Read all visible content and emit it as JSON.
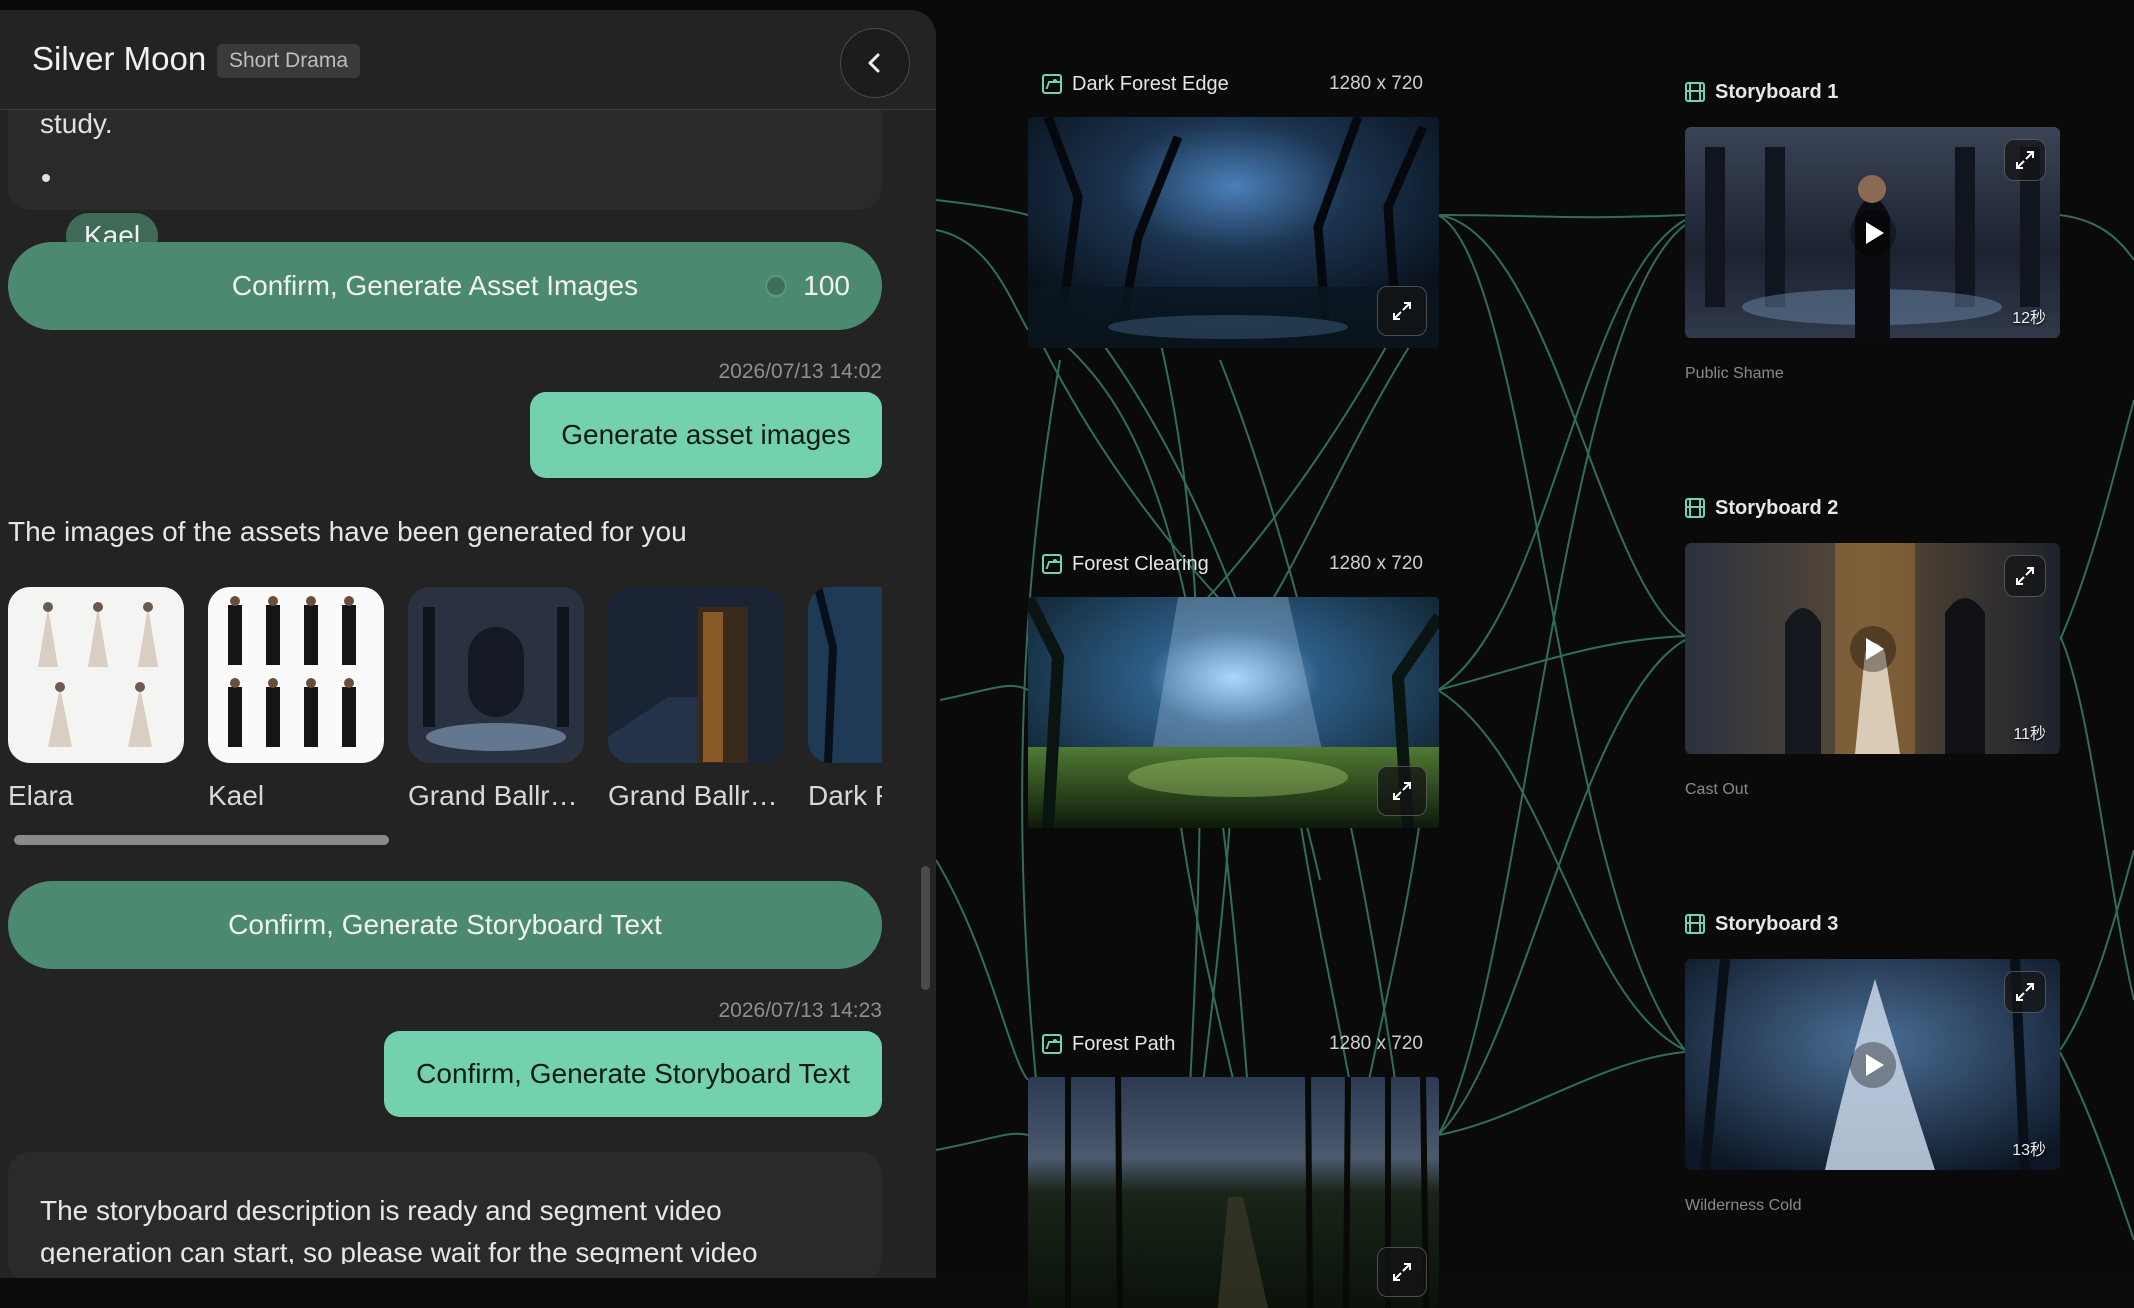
{
  "chat": {
    "title": "Silver Moon",
    "tag": "Short Drama",
    "back_icon": "chevron-left-icon",
    "partial_text": "study.",
    "character_chip": "Kael",
    "confirm_assets_label": "Confirm, Generate Asset Images",
    "credit_cost": "100",
    "msg1_time": "2026/07/13 14:02",
    "msg1_text": "Generate asset images",
    "assets_intro": "The images of the assets have been generated for you",
    "assets": [
      {
        "name": "Elara"
      },
      {
        "name": "Kael"
      },
      {
        "name": "Grand Ballroom"
      },
      {
        "name": "Grand Ballroom"
      },
      {
        "name": "Dark Forest Edge"
      }
    ],
    "confirm_storyboard_label": "Confirm, Generate Storyboard Text",
    "msg2_time": "2026/07/13 14:23",
    "msg2_text": "Confirm, Generate Storyboard Text",
    "final_text": "The storyboard description is ready and segment video generation can start, so please wait for the segment video"
  },
  "canvas": {
    "image_nodes": [
      {
        "title": "Dark Forest Edge",
        "resolution": "1280 x 720"
      },
      {
        "title": "Forest Clearing",
        "resolution": "1280 x 720"
      },
      {
        "title": "Forest Path",
        "resolution": "1280 x 720"
      }
    ],
    "storyboards": [
      {
        "title": "Storyboard 1",
        "duration": "12秒",
        "caption": "Public Shame"
      },
      {
        "title": "Storyboard 2",
        "duration": "11秒",
        "caption": "Cast Out"
      },
      {
        "title": "Storyboard 3",
        "duration": "13秒",
        "caption": "Wilderness Cold"
      }
    ],
    "colors": {
      "wire": "#4fa888",
      "accent": "#73d1ae",
      "button": "#4b8a70"
    }
  }
}
